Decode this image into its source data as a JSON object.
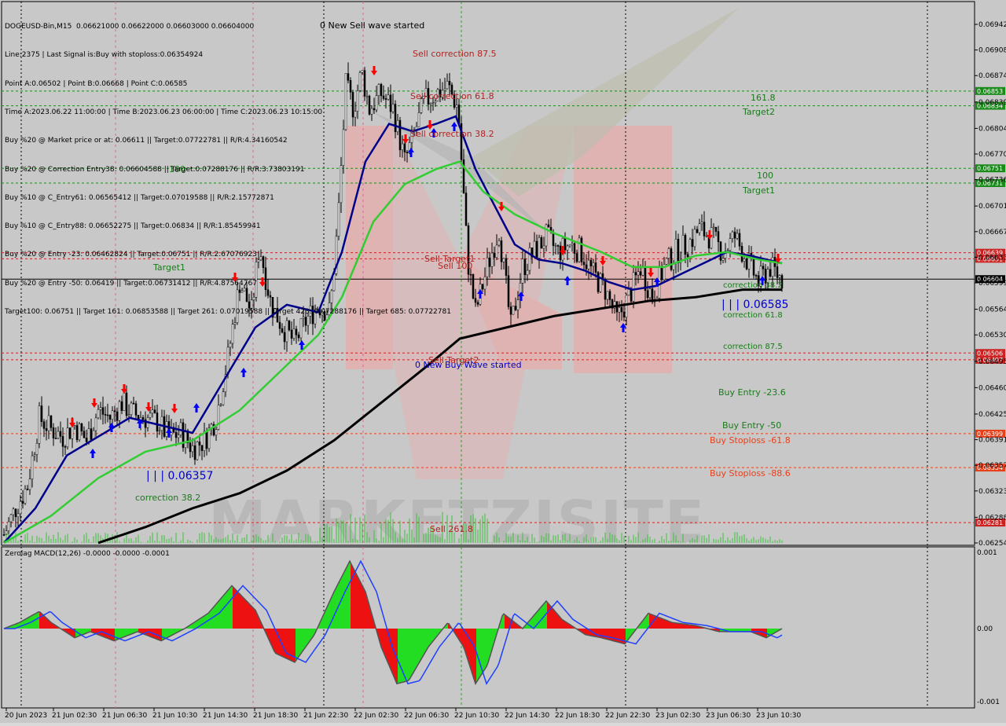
{
  "header": {
    "info_lines": [
      "DOGEUSD-Bin,M15  0.06621000 0.06622000 0.06603000 0.06604000",
      "Line:2375 | Last Signal is:Buy with stoploss:0.06354924",
      "Point A:0.06502 | Point B:0.06668 | Point C:0.06585",
      "Time A:2023.06.22 11:00:00 | Time B:2023.06.23 06:00:00 | Time C:2023.06.23 10:15:00",
      "Buy %20 @ Market price or at: 0.06611 || Target:0.07722781 || R/R:4.34160542",
      "Buy %20 @ Correction Entry38: 0.06604588 || Target:0.07288176 || R/R:3.73803191",
      "Buy %10 @ C_Entry61: 0.06565412 || Target:0.07019588 || R/R:2.15772871",
      "Buy %10 @ C_Entry88: 0.06652275 || Target:0.06834 || R/R:1.85459941",
      "Buy %20 @ Entry -23: 0.06462824 || Target:0.06751 || R/R:2.67076923",
      "Buy %20 @ Entry -50: 0.06419 || Target:0.06731412 || R/R:4.87564767",
      "Target100: 0.06751 || Target 161: 0.06853588 || Target 261: 0.07019588 || Target 423: 0.07288176 || Target 685: 0.07722781"
    ]
  },
  "main_chart": {
    "annotations": {
      "sell_wave_top": "0 New Sell wave started",
      "sell_wave_bottom": "0 New Buy Wave started",
      "sell_correction_875": "Sell correction 87.5",
      "sell_correction_618": "Sell correction 61.8",
      "sell_correction_382": "Sell correction 38.2",
      "sell_target1": "Sell Target1",
      "sell_100": "Sell 100",
      "sell_target2": "Sell Target2",
      "sell_2618": "Sell 261.8",
      "left_100": "100",
      "left_target1": "Target1",
      "left_correction382": "correction 38.2",
      "low_label": "| | | 0.06357",
      "label_1618": "161.8",
      "label_target2": "Target2",
      "right_100": "100",
      "right_target1": "Target1",
      "right_correction382": "correction 38.2",
      "point_c_label": "| | | 0.06585",
      "right_correction618": "correction 61.8",
      "right_correction875": "correction 87.5",
      "buy_entry_236": "Buy Entry -23.6",
      "buy_entry_50": "Buy Entry -50",
      "buy_stoploss_618": "Buy Stoploss -61.8",
      "buy_stoploss_886": "Buy Stoploss -88.6"
    },
    "watermark": "MARKETZISITE"
  },
  "macd": {
    "title": "Zerolag MACD(12,26) -0.0000 -0.0000 -0.0001",
    "ticks": [
      "0.001",
      "0.00",
      "-0.001"
    ]
  },
  "colors": {
    "background": "#c8c8c8",
    "fast_ma": "#00008b",
    "slow_ma": "#32cd32",
    "long_ma": "#000000",
    "buy_arrow": "#0000ff",
    "sell_arrow": "#ff0000",
    "target_line": "#008000",
    "sell_line": "#cc2222",
    "stoploss_label": "#e8401a"
  },
  "chart_data": {
    "type": "line",
    "title": "DOGEUSD-Bin,M15",
    "price_axis": {
      "ylim": [
        0.06254,
        0.06942
      ],
      "ticks": [
        "0.06942",
        "0.06908",
        "0.06874",
        "0.06839",
        "0.06804",
        "0.06770",
        "0.06736",
        "0.06701",
        "0.06667",
        "0.06633",
        "0.06599",
        "0.06564",
        "0.06530",
        "0.06495",
        "0.06460",
        "0.06425",
        "0.06391",
        "0.06357",
        "0.06323",
        "0.06288",
        "0.06254"
      ]
    },
    "time_axis": {
      "ticks": [
        "20 Jun 2023",
        "21 Jun 02:30",
        "21 Jun 06:30",
        "21 Jun 10:30",
        "21 Jun 14:30",
        "21 Jun 18:30",
        "21 Jun 22:30",
        "22 Jun 02:30",
        "22 Jun 06:30",
        "22 Jun 10:30",
        "22 Jun 14:30",
        "22 Jun 18:30",
        "22 Jun 22:30",
        "23 Jun 02:30",
        "23 Jun 06:30",
        "23 Jun 10:30"
      ]
    },
    "level_lines": [
      {
        "value": 0.06853588,
        "label": "0.06853",
        "color": "#1a8a1a",
        "style": "dashed"
      },
      {
        "value": 0.06834,
        "label": "0.06834",
        "color": "#1a8a1a",
        "style": "dashed"
      },
      {
        "value": 0.06751,
        "label": "0.06751",
        "color": "#1a8a1a",
        "style": "dashed"
      },
      {
        "value": 0.06731412,
        "label": "0.06731",
        "color": "#1a8a1a",
        "style": "dashed"
      },
      {
        "value": 0.06639,
        "label": "0.06639",
        "color": "#cc2222",
        "style": "dashed"
      },
      {
        "value": 0.06631,
        "label": "0.06631",
        "color": "#cc2222",
        "style": "dashed"
      },
      {
        "value": 0.06604,
        "label": "0.06604",
        "color": "#000000",
        "style": "solid"
      },
      {
        "value": 0.06506,
        "label": "0.06506",
        "color": "#cc2222",
        "style": "dashed"
      },
      {
        "value": 0.06497,
        "label": "0.06497",
        "color": "#cc2222",
        "style": "dashed"
      },
      {
        "value": 0.06399,
        "label": "0.06399",
        "color": "#e8401a",
        "style": "dashed"
      },
      {
        "value": 0.06354,
        "label": "0.06354",
        "color": "#e8401a",
        "style": "dashed"
      },
      {
        "value": 0.06281,
        "label": "0.06281",
        "color": "#cc2222",
        "style": "dashed"
      }
    ],
    "price_path": [
      [
        0,
        0.06265
      ],
      [
        15,
        0.063
      ],
      [
        30,
        0.0633
      ],
      [
        45,
        0.0642
      ],
      [
        60,
        0.06405
      ],
      [
        75,
        0.06395
      ],
      [
        90,
        0.0641
      ],
      [
        105,
        0.0639
      ],
      [
        120,
        0.0643
      ],
      [
        135,
        0.0642
      ],
      [
        150,
        0.0644
      ],
      [
        165,
        0.06425
      ],
      [
        180,
        0.0642
      ],
      [
        195,
        0.06415
      ],
      [
        210,
        0.06395
      ],
      [
        225,
        0.064
      ],
      [
        240,
        0.0638
      ],
      [
        255,
        0.0639
      ],
      [
        270,
        0.0642
      ],
      [
        285,
        0.065
      ],
      [
        300,
        0.066
      ],
      [
        315,
        0.0656
      ],
      [
        325,
        0.0665
      ],
      [
        340,
        0.0657
      ],
      [
        355,
        0.0654
      ],
      [
        370,
        0.0652
      ],
      [
        385,
        0.0655
      ],
      [
        400,
        0.0657
      ],
      [
        415,
        0.0656
      ],
      [
        425,
        0.0668
      ],
      [
        435,
        0.0686
      ],
      [
        445,
        0.0683
      ],
      [
        455,
        0.0688
      ],
      [
        465,
        0.0683
      ],
      [
        480,
        0.0685
      ],
      [
        495,
        0.0683
      ],
      [
        510,
        0.0676
      ],
      [
        520,
        0.0679
      ],
      [
        535,
        0.0684
      ],
      [
        550,
        0.0685
      ],
      [
        565,
        0.0686
      ],
      [
        578,
        0.0683
      ],
      [
        590,
        0.0663
      ],
      [
        600,
        0.0656
      ],
      [
        615,
        0.0662
      ],
      [
        630,
        0.0667
      ],
      [
        645,
        0.0654
      ],
      [
        660,
        0.0662
      ],
      [
        675,
        0.0664
      ],
      [
        690,
        0.0666
      ],
      [
        705,
        0.0664
      ],
      [
        720,
        0.0665
      ],
      [
        735,
        0.0664
      ],
      [
        750,
        0.0661
      ],
      [
        765,
        0.0659
      ],
      [
        780,
        0.0655
      ],
      [
        795,
        0.0658
      ],
      [
        810,
        0.0662
      ],
      [
        825,
        0.0658
      ],
      [
        840,
        0.0662
      ],
      [
        855,
        0.0664
      ],
      [
        870,
        0.0665
      ],
      [
        885,
        0.0667
      ],
      [
        900,
        0.0666
      ],
      [
        915,
        0.0664
      ],
      [
        930,
        0.0666
      ],
      [
        945,
        0.0663
      ],
      [
        960,
        0.066
      ],
      [
        975,
        0.0662
      ],
      [
        990,
        0.06604
      ]
    ],
    "series": [
      {
        "values": [
          [
            0,
            0.06254
          ],
          [
            40,
            0.063
          ],
          [
            80,
            0.0637
          ],
          [
            120,
            0.06395
          ],
          [
            160,
            0.0642
          ],
          [
            200,
            0.0641
          ],
          [
            240,
            0.064
          ],
          [
            280,
            0.0647
          ],
          [
            320,
            0.0654
          ],
          [
            360,
            0.0657
          ],
          [
            400,
            0.0656
          ],
          [
            430,
            0.0664
          ],
          [
            460,
            0.0676
          ],
          [
            490,
            0.0681
          ],
          [
            520,
            0.068
          ],
          [
            550,
            0.0681
          ],
          [
            575,
            0.0682
          ],
          [
            600,
            0.0675
          ],
          [
            625,
            0.067
          ],
          [
            650,
            0.0665
          ],
          [
            680,
            0.0663
          ],
          [
            710,
            0.06625
          ],
          [
            740,
            0.06615
          ],
          [
            770,
            0.066
          ],
          [
            800,
            0.0659
          ],
          [
            830,
            0.06595
          ],
          [
            860,
            0.0661
          ],
          [
            890,
            0.06625
          ],
          [
            920,
            0.0664
          ],
          [
            950,
            0.06635
          ],
          [
            990,
            0.06625
          ]
        ]
      },
      {
        "values": [
          [
            0,
            0.06254
          ],
          [
            60,
            0.0629
          ],
          [
            120,
            0.0634
          ],
          [
            180,
            0.06375
          ],
          [
            240,
            0.0639
          ],
          [
            300,
            0.0643
          ],
          [
            360,
            0.0649
          ],
          [
            400,
            0.0653
          ],
          [
            430,
            0.0658
          ],
          [
            470,
            0.0668
          ],
          [
            510,
            0.0673
          ],
          [
            550,
            0.0675
          ],
          [
            580,
            0.0676
          ],
          [
            610,
            0.0672
          ],
          [
            650,
            0.0669
          ],
          [
            700,
            0.06665
          ],
          [
            760,
            0.0664
          ],
          [
            800,
            0.0662
          ],
          [
            840,
            0.0662
          ],
          [
            880,
            0.06635
          ],
          [
            920,
            0.0664
          ],
          [
            960,
            0.0663
          ],
          [
            990,
            0.06625
          ]
        ]
      },
      {
        "values": [
          [
            120,
            0.06254
          ],
          [
            180,
            0.06275
          ],
          [
            240,
            0.063
          ],
          [
            300,
            0.0632
          ],
          [
            360,
            0.0635
          ],
          [
            420,
            0.0639
          ],
          [
            480,
            0.0644
          ],
          [
            540,
            0.0649
          ],
          [
            580,
            0.06525
          ],
          [
            640,
            0.0654
          ],
          [
            700,
            0.06555
          ],
          [
            760,
            0.06565
          ],
          [
            820,
            0.06575
          ],
          [
            880,
            0.0658
          ],
          [
            940,
            0.0659
          ],
          [
            990,
            0.0659
          ]
        ]
      }
    ]
  }
}
